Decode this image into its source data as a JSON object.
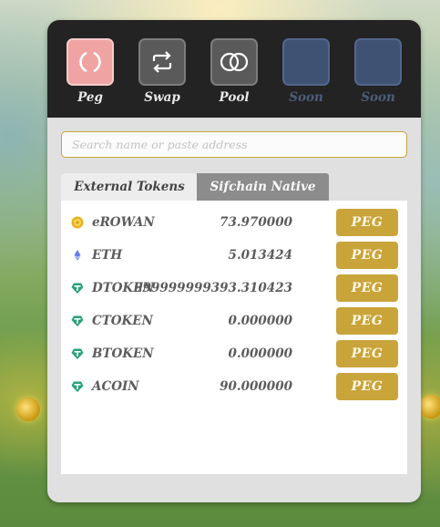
{
  "nav": {
    "items": [
      {
        "label": "Peg",
        "icon": "peg-cycle-icon",
        "state": "active"
      },
      {
        "label": "Swap",
        "icon": "swap-arrows-icon",
        "state": "enabled"
      },
      {
        "label": "Pool",
        "icon": "pool-rings-icon",
        "state": "enabled"
      },
      {
        "label": "Soon",
        "icon": "",
        "state": "disabled"
      },
      {
        "label": "Soon",
        "icon": "",
        "state": "disabled"
      }
    ]
  },
  "search": {
    "placeholder": "Search name or paste address",
    "value": ""
  },
  "tabs": [
    {
      "label": "External Tokens",
      "active": true
    },
    {
      "label": "Sifchain Native",
      "active": false
    }
  ],
  "tokens": [
    {
      "symbol": "eROWAN",
      "balance": "73.970000",
      "icon": "rowan-coin-icon",
      "action": "PEG"
    },
    {
      "symbol": "ETH",
      "balance": "5.013424",
      "icon": "ethereum-icon",
      "action": "PEG"
    },
    {
      "symbol": "DTOKEN",
      "balance": "999999999393.310423",
      "icon": "tether-icon",
      "action": "PEG"
    },
    {
      "symbol": "CTOKEN",
      "balance": "0.000000",
      "icon": "tether-icon",
      "action": "PEG"
    },
    {
      "symbol": "BTOKEN",
      "balance": "0.000000",
      "icon": "tether-icon",
      "action": "PEG"
    },
    {
      "symbol": "ACOIN",
      "balance": "90.000000",
      "icon": "tether-icon",
      "action": "PEG"
    }
  ],
  "colors": {
    "accent_gold": "#c9a43a",
    "peg_active": "#f0a3a3",
    "soon_disabled": "#3f5274",
    "tether_green": "#26a17b",
    "topbar_bg": "#232323"
  }
}
